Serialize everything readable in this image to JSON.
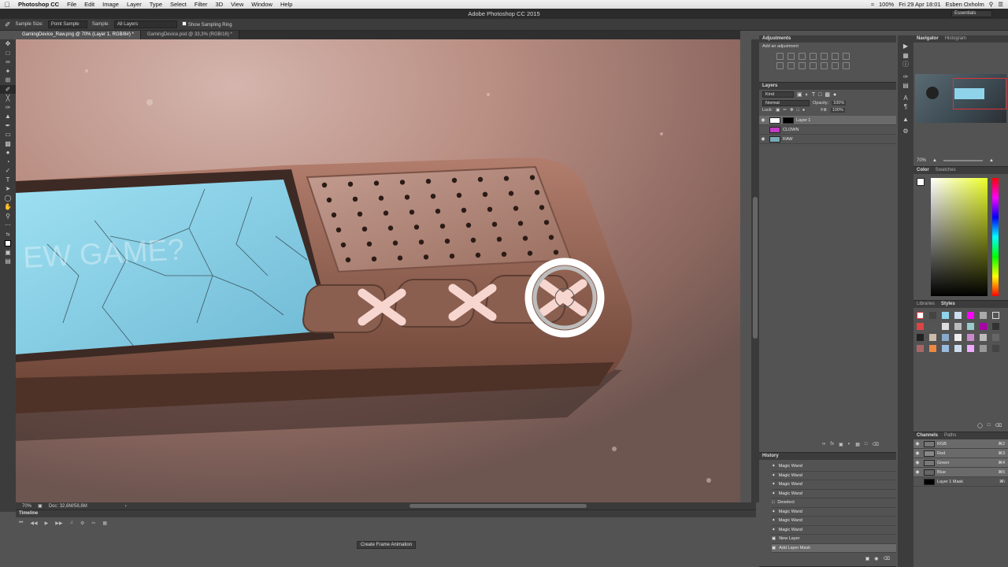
{
  "menubar": {
    "app": "Photoshop CC",
    "items": [
      "File",
      "Edit",
      "Image",
      "Layer",
      "Type",
      "Select",
      "Filter",
      "3D",
      "View",
      "Window",
      "Help"
    ],
    "right": [
      "100%",
      "Fri 29 Apr 18:01",
      "Esben Oxholm"
    ]
  },
  "titlebar": {
    "title": "Adobe Photoshop CC 2015",
    "workspace": "Essentials"
  },
  "options": {
    "sample_size_label": "Sample Size:",
    "sample_size_value": "Point Sample",
    "sample_label": "Sample:",
    "sample_value": "All Layers",
    "show_ring_label": "Show Sampling Ring"
  },
  "tabs": [
    {
      "label": "GamingDevice_Raw.png @ 70% (Layer 1, RGB/8#) *"
    },
    {
      "label": "GamingDevice.psd @ 33,3% (RGB/16) *"
    }
  ],
  "status": {
    "zoom": "70%",
    "doc": "Doc: 32,6M/58,8M"
  },
  "timeline": {
    "title": "Timeline",
    "create_button": "Create Frame Animation"
  },
  "adjustments": {
    "title": "Adjustments",
    "subtitle": "Add an adjustment"
  },
  "layers": {
    "title": "Layers",
    "kind": "Kind",
    "blend": "Normal",
    "opacity_label": "Opacity:",
    "opacity_value": "100%",
    "lock_label": "Lock:",
    "fill_label": "Fill:",
    "fill_value": "100%",
    "items": [
      {
        "name": "Layer 1"
      },
      {
        "name": "CLOWN"
      },
      {
        "name": "RAW"
      }
    ]
  },
  "history": {
    "title": "History",
    "items": [
      {
        "name": "Magic Wand"
      },
      {
        "name": "Magic Wand"
      },
      {
        "name": "Magic Wand"
      },
      {
        "name": "Magic Wand"
      },
      {
        "name": "Deselect"
      },
      {
        "name": "Magic Wand"
      },
      {
        "name": "Magic Wand"
      },
      {
        "name": "Magic Wand"
      },
      {
        "name": "New Layer"
      },
      {
        "name": "Add Layer Mask"
      }
    ]
  },
  "navigator": {
    "title": "Navigator",
    "tab2": "Histogram",
    "zoom": "70%"
  },
  "color": {
    "title": "Color",
    "tab2": "Swatches"
  },
  "styles": {
    "tab1": "Libraries",
    "title": "Styles"
  },
  "channels": {
    "title": "Channels",
    "tab2": "Paths",
    "items": [
      {
        "name": "RGB",
        "key": "⌘2"
      },
      {
        "name": "Red",
        "key": "⌘3"
      },
      {
        "name": "Green",
        "key": "⌘4"
      },
      {
        "name": "Blue",
        "key": "⌘5"
      },
      {
        "name": "Layer 1 Mask",
        "key": "⌘\\"
      }
    ]
  },
  "canvas": {
    "screen_text": "EW GAME?"
  },
  "colors": {
    "accent_red": "#e0313a",
    "screen_blue": "#8fd3ea",
    "ui_dark": "#3c3c3c",
    "ui_mid": "#535353"
  }
}
